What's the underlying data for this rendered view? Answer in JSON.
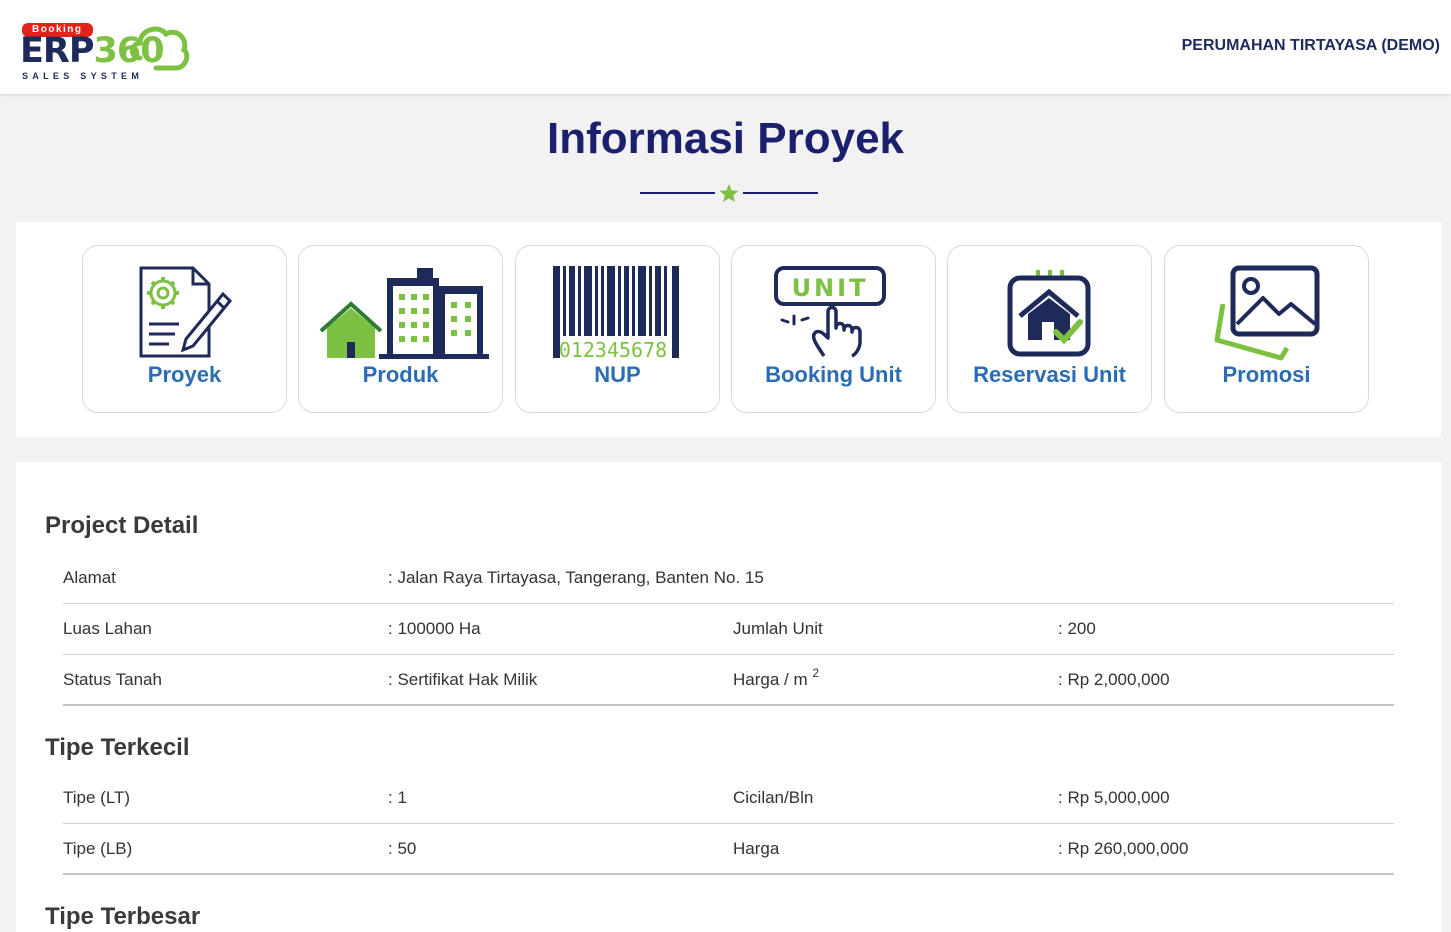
{
  "header": {
    "logo": {
      "badge": "Booking",
      "brand_text": "ERP",
      "brand_number": "360",
      "tagline": "SALES SYSTEM"
    },
    "company_name": "PERUMAHAN TIRTAYASA (DEMO)"
  },
  "page": {
    "title": "Informasi Proyek"
  },
  "menu": [
    {
      "label": "Proyek",
      "icon": "document-gear-pen-icon"
    },
    {
      "label": "Produk",
      "icon": "house-buildings-icon"
    },
    {
      "label": "NUP",
      "icon": "barcode-icon",
      "barcode_text": "012345678"
    },
    {
      "label": "Booking Unit",
      "icon": "unit-tap-icon",
      "badge_text": "UNIT"
    },
    {
      "label": "Reservasi Unit",
      "icon": "calendar-house-check-icon"
    },
    {
      "label": "Promosi",
      "icon": "image-gallery-icon"
    }
  ],
  "project_detail": {
    "title": "Project Detail",
    "alamat": {
      "label": "Alamat",
      "value": ": Jalan Raya Tirtayasa, Tangerang, Banten No. 15"
    },
    "luas_lahan": {
      "label": "Luas Lahan",
      "value": ": 100000 Ha"
    },
    "jumlah_unit": {
      "label": "Jumlah Unit",
      "value": ": 200"
    },
    "status_tanah": {
      "label": "Status Tanah",
      "value": ": Sertifikat Hak Milik"
    },
    "harga_m2": {
      "label": "Harga / m",
      "sup": "2",
      "value": ": Rp 2,000,000"
    }
  },
  "tipe_terkecil": {
    "title": "Tipe Terkecil",
    "tipe_lt": {
      "label": "Tipe (LT)",
      "value": ": 1"
    },
    "cicilan": {
      "label": "Cicilan/Bln",
      "value": ": Rp 5,000,000"
    },
    "tipe_lb": {
      "label": "Tipe (LB)",
      "value": ": 50"
    },
    "harga": {
      "label": "Harga",
      "value": ": Rp 260,000,000"
    }
  },
  "tipe_terbesar": {
    "title": "Tipe Terbesar"
  },
  "colors": {
    "navy": "#1a1f6e",
    "blue_label": "#2a6db5",
    "green": "#7cc142",
    "red": "#e2231a"
  }
}
